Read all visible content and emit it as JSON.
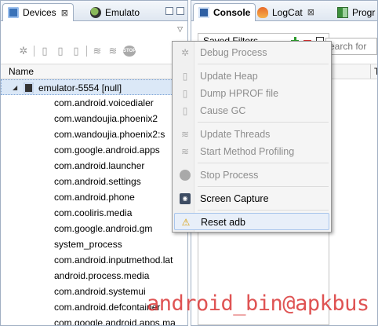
{
  "left_view": {
    "tabs": [
      {
        "label": "Devices",
        "close": "⊠",
        "icon": "devices-icon",
        "active": true
      },
      {
        "label": "Emulato",
        "icon": "emulator-icon",
        "active": false
      }
    ],
    "column_header": "Name",
    "device": {
      "label": "emulator-5554 [null]",
      "expander": "◢"
    },
    "processes": [
      "com.android.voicedialer",
      "com.wandoujia.phoenix2",
      "com.wandoujia.phoenix2:s",
      "com.google.android.apps",
      "com.android.launcher",
      "com.android.settings",
      "com.android.phone",
      "com.cooliris.media",
      "com.google.android.gm",
      "system_process",
      "com.android.inputmethod.lat",
      "android.process.media",
      "com.android.systemui",
      "com.android.defcontainer",
      "com.google.android.apps.ma"
    ],
    "toolbar_icons": [
      "debug-icon",
      "update-heap-icon",
      "dump-hprof-icon",
      "cause-gc-icon",
      "update-threads-icon",
      "method-profiling-icon",
      "stop-process-icon"
    ]
  },
  "right_view": {
    "tabs": [
      {
        "label": "Console",
        "icon": "console-icon",
        "active": true
      },
      {
        "label": "LogCat",
        "close": "⊠",
        "icon": "logcat-icon",
        "active": false
      },
      {
        "label": "Progr",
        "icon": "progress-icon",
        "active": false
      }
    ],
    "saved_filters_label": "Saved Filters",
    "search_placeholder": "earch for",
    "log_column_partial": "T"
  },
  "context_menu": {
    "items": [
      {
        "label": "Debug Process",
        "enabled": false,
        "icon": "bug-icon"
      },
      {
        "label": "Update Heap",
        "enabled": false,
        "icon": "heap-icon"
      },
      {
        "label": "Dump HPROF file",
        "enabled": false,
        "icon": "hprof-icon"
      },
      {
        "label": "Cause GC",
        "enabled": false,
        "icon": "gc-icon"
      },
      {
        "label": "Update Threads",
        "enabled": false,
        "icon": "threads-icon"
      },
      {
        "label": "Start Method Profiling",
        "enabled": false,
        "icon": "profiling-icon"
      },
      {
        "label": "Stop Process",
        "enabled": false,
        "icon": "stop-icon"
      },
      {
        "label": "Screen Capture",
        "enabled": true,
        "icon": "camera-icon"
      },
      {
        "label": "Reset adb",
        "enabled": true,
        "icon": "warning-icon",
        "highlighted": true
      }
    ]
  },
  "watermark": "android_bin@apkbus",
  "colors": {
    "tab_border": "#a0afc3",
    "selection_bg": "#dbe8f7",
    "menu_highlight": "#e8eff9",
    "watermark": "#d72828"
  }
}
